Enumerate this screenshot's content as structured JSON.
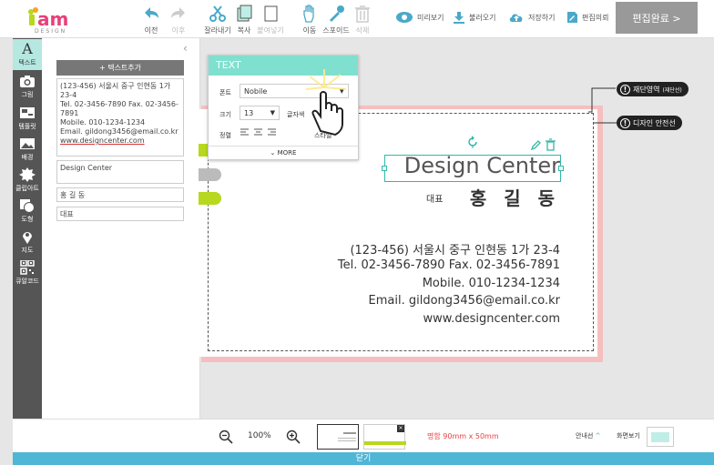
{
  "brand": {
    "logo_text": "oam",
    "logo_sub": "DESIGN",
    "accent": "#b7d81e",
    "teal": "#7fe0cf"
  },
  "toolbar": {
    "undo": "이전",
    "redo": "이후",
    "cut": "잘라내기",
    "copy": "복사",
    "paste": "붙여넣기",
    "move": "이동",
    "eyedropper": "스포이드",
    "delete": "삭제",
    "preview": "미리보기",
    "load": "불러오기",
    "save": "저장하기",
    "edit_opinion": "편집의뢰",
    "done": "편집완료 >"
  },
  "sidebar": {
    "items": [
      {
        "label": "텍스트",
        "icon": "text-icon"
      },
      {
        "label": "그림",
        "icon": "camera-icon"
      },
      {
        "label": "템플릿",
        "icon": "template-icon"
      },
      {
        "label": "배경",
        "icon": "image-icon"
      },
      {
        "label": "클립아트",
        "icon": "clipart-icon"
      },
      {
        "label": "도형",
        "icon": "shape-icon"
      },
      {
        "label": "지도",
        "icon": "map-pin-icon"
      },
      {
        "label": "큐알코드",
        "icon": "qr-code-icon"
      }
    ]
  },
  "textpanel": {
    "add_button": "+ 텍스트추가",
    "field1_lines": [
      "(123-456) 서울시 중구 인현동 1가",
      "23-4",
      "Tel. 02-3456-7890  Fax. 02-3456-",
      "7891",
      "Mobile. 010-1234-1234",
      "Email. gildong3456@email.co.kr",
      "www.designcenter.com"
    ],
    "field2": "Design Center",
    "field3": "홍 길 동",
    "field4": "대표"
  },
  "popup": {
    "title": "TEXT",
    "font_label": "폰트",
    "font_value": "Nobile",
    "size_label": "크기",
    "size_value": "13",
    "spacing_label": "글자색",
    "align_label": "정렬",
    "style_label": "스타일",
    "more": "MORE"
  },
  "card": {
    "company": "Design Center",
    "title": "대표",
    "name": "홍 길 동",
    "address": "(123-456) 서울시 중구 인현동 1가 23-4",
    "tel": "Tel. 02-3456-7890   Fax. 02-3456-7891",
    "mobile": "Mobile. 010-1234-1234",
    "email": "Email. gildong3456@email.co.kr",
    "web": "www.designcenter.com"
  },
  "tags": {
    "cut_area": "재단영역",
    "cut_area_sub": "(재단선)",
    "safe_line": "디자인 안전선"
  },
  "bottom": {
    "zoom": "100%",
    "size_info": "명함 90mm x 50mm",
    "guide": "안내선",
    "view": "화면보기",
    "close": "닫기"
  }
}
